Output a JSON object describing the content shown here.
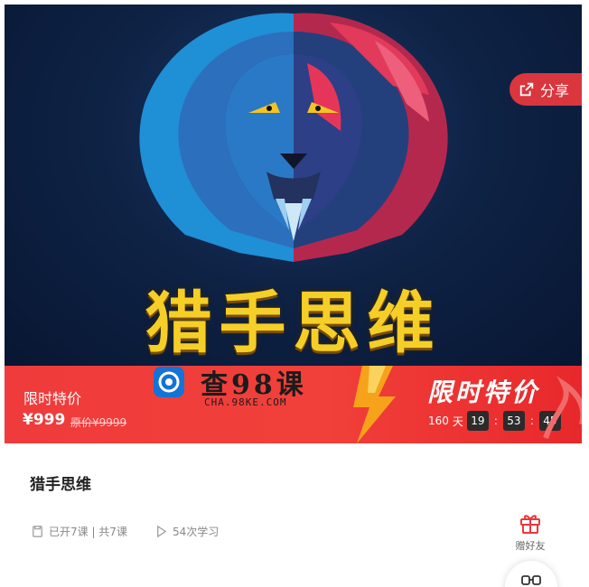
{
  "banner": {
    "title": "猎手思维",
    "share_label": "分享"
  },
  "pricebar": {
    "label": "限时特价",
    "price": "¥999",
    "original_price": "原价¥9999",
    "slogan": "限时特价",
    "countdown": {
      "days": "160",
      "days_unit": "天",
      "hours": "19",
      "minutes": "53",
      "seconds": "45",
      "separator": ":"
    }
  },
  "watermark": {
    "title": "查98课",
    "subtitle": "CHA.98KE.COM"
  },
  "course": {
    "title": "猎手思维",
    "lessons": "已开7课 | 共7课",
    "views": "54次学习",
    "gift_label": "赠好友"
  },
  "colors": {
    "accent_red": "#ef3b3b",
    "title_gold": "#f5cf27",
    "share_red": "#d9363e"
  },
  "icons": [
    "share-icon",
    "lesson-icon",
    "play-icon",
    "gift-icon",
    "headphone-icon"
  ]
}
